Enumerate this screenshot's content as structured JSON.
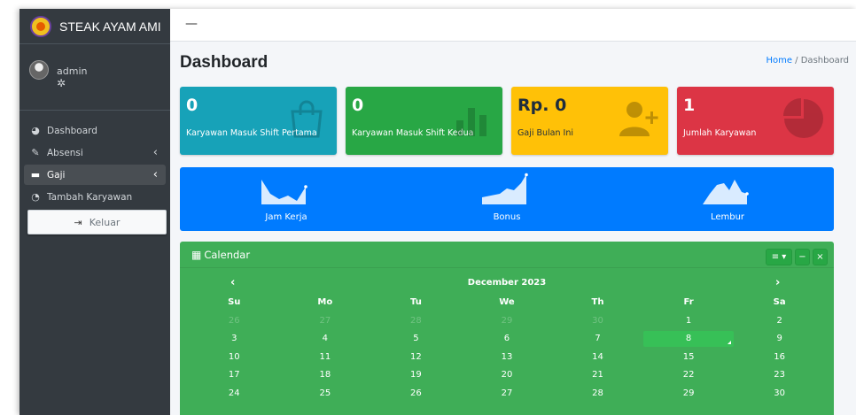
{
  "brand": {
    "name": "STEAK AYAM AMI"
  },
  "user": {
    "name": "admin"
  },
  "sidebar": {
    "items": [
      {
        "label": "Dashboard",
        "icon": "dashboard-icon"
      },
      {
        "label": "Absensi",
        "icon": "edit-icon"
      },
      {
        "label": "Gaji",
        "icon": "wallet-icon"
      },
      {
        "label": "Tambah Karyawan",
        "icon": "chart-pie-icon"
      }
    ],
    "logout_label": "Keluar"
  },
  "header": {
    "title": "Dashboard",
    "breadcrumb_home": "Home",
    "breadcrumb_sep": "/",
    "breadcrumb_current": "Dashboard"
  },
  "stats": [
    {
      "value": "0",
      "label": "Karyawan Masuk Shift Pertama",
      "color": "#17a2b8",
      "icon": "shopping-bag-icon"
    },
    {
      "value": "0",
      "label": "Karyawan Masuk Shift Kedua",
      "color": "#28a745",
      "icon": "bar-chart-icon"
    },
    {
      "value": "Rp. 0",
      "label": "Gaji Bulan Ini",
      "color": "#ffc107",
      "icon": "user-plus-icon"
    },
    {
      "value": "1",
      "label": "Jumlah Karyawan",
      "color": "#dc3545",
      "icon": "pie-chart-icon"
    }
  ],
  "sparklines": [
    {
      "label": "Jam Kerja"
    },
    {
      "label": "Bonus"
    },
    {
      "label": "Lembur"
    }
  ],
  "calendar": {
    "title": "Calendar",
    "month": "December 2023",
    "prev": "‹",
    "next": "›",
    "days": [
      "Su",
      "Mo",
      "Tu",
      "We",
      "Th",
      "Fr",
      "Sa"
    ],
    "weeks": [
      [
        "26",
        "27",
        "28",
        "29",
        "30",
        "1",
        "2"
      ],
      [
        "3",
        "4",
        "5",
        "6",
        "7",
        "8",
        "9"
      ],
      [
        "10",
        "11",
        "12",
        "13",
        "14",
        "15",
        "16"
      ],
      [
        "17",
        "18",
        "19",
        "20",
        "21",
        "22",
        "23"
      ],
      [
        "24",
        "25",
        "26",
        "27",
        "28",
        "29",
        "30"
      ]
    ],
    "today": "8"
  },
  "colors": {
    "sidebar": "#343a40",
    "primary": "#007bff",
    "calendar": "#3fae57"
  }
}
